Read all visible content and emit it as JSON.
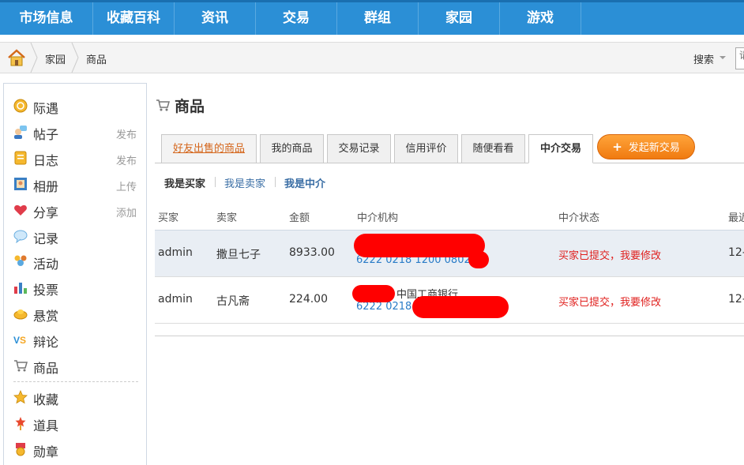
{
  "topnav": {
    "items": [
      "市场信息",
      "收藏百科",
      "资讯",
      "交易",
      "群组",
      "家园",
      "游戏"
    ]
  },
  "breadcrumb": {
    "items": [
      "家园",
      "商品"
    ],
    "search_label": "搜索",
    "search_value": "请"
  },
  "sidebar": {
    "items": [
      {
        "label": "际遇",
        "action": "",
        "icon": "coin-icon"
      },
      {
        "label": "帖子",
        "action": "发布",
        "icon": "chat-user-icon"
      },
      {
        "label": "日志",
        "action": "发布",
        "icon": "notepad-icon"
      },
      {
        "label": "相册",
        "action": "上传",
        "icon": "photo-frame-icon"
      },
      {
        "label": "分享",
        "action": "添加",
        "icon": "heart-icon"
      },
      {
        "label": "记录",
        "action": "",
        "icon": "speech-bubble-icon"
      },
      {
        "label": "活动",
        "action": "",
        "icon": "people-icon"
      },
      {
        "label": "投票",
        "action": "",
        "icon": "bar-chart-icon"
      },
      {
        "label": "悬赏",
        "action": "",
        "icon": "gold-ingot-icon"
      },
      {
        "label": "辩论",
        "action": "",
        "icon": "vs-icon"
      },
      {
        "label": "商品",
        "action": "",
        "icon": "shopping-cart-icon"
      },
      {
        "label": "收藏",
        "action": "",
        "icon": "star-icon"
      },
      {
        "label": "道具",
        "action": "",
        "icon": "magic-wand-icon"
      },
      {
        "label": "勋章",
        "action": "",
        "icon": "medal-icon"
      }
    ]
  },
  "main": {
    "title": "商品",
    "tabs": [
      "好友出售的商品",
      "我的商品",
      "交易记录",
      "信用评价",
      "随便看看",
      "中介交易"
    ],
    "new_trade_label": "发起新交易",
    "subtabs": [
      "我是买家",
      "我是卖家",
      "我是中介"
    ],
    "table": {
      "headers": [
        "买家",
        "卖家",
        "金额",
        "中介机构",
        "中介状态",
        "最近"
      ],
      "rows": [
        {
          "buyer": "admin",
          "seller": "撒旦七子",
          "amount": "8933.00",
          "agency_name": "",
          "agency_account": "6222 0218 1200 0802 0",
          "status": "买家已提交，我要修改",
          "recent": "12-"
        },
        {
          "buyer": "admin",
          "seller": "古凡斋",
          "amount": "224.00",
          "agency_name": "中国工商银行",
          "agency_account": "6222 0218",
          "status": "买家已提交，我要修改",
          "recent": "12-"
        }
      ]
    }
  },
  "colors": {
    "nav_blue": "#2b8fd6",
    "status_red": "#e0201e",
    "link_blue": "#2a7cc7",
    "button_orange": "#f07a10"
  }
}
